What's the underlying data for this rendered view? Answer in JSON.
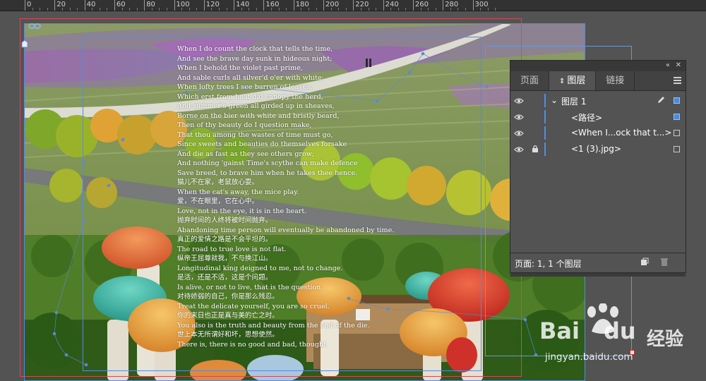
{
  "ruler": {
    "labels": [
      "0",
      "20",
      "40",
      "60",
      "80",
      "100",
      "120",
      "140",
      "160",
      "180",
      "200",
      "220",
      "240",
      "260",
      "280",
      "300"
    ]
  },
  "poem": {
    "lines": [
      "When I do count the clock that tells the time,",
      "And see the brave day sunk in hideous night;",
      "When I behold the violet past prime,",
      "And sable curls all silver'd o'er with white;",
      "When lofty trees I see barren of leaves,",
      "Which erst from heat did canopy the herd,",
      "And summer's green all girded up in sheaves,",
      "Borne on the bier with white and bristly beard,",
      "Then of thy beauty do I question make,",
      "That thou among the wastes of time must go,",
      "Since sweets and beauties do themselves forsake",
      "And die as fast as they see others grow;",
      "And nothing 'gainst Time's scythe can make defence",
      "Save breed, to brave him when he takes thee hence.",
      "猫儿不在家，老鼠放心耍。",
      "When the cat's away, the mice play.",
      "爱，不在眼里，它在心中。",
      "Love, not in the eye, it is in the heart.",
      "抛弃时间的人终将被时间抛弃。",
      "Abandoning time person will eventually be abandoned by time.",
      "真正的爱情之路是不会平坦的。",
      "The road to true love is not flat.",
      "纵帝王屈尊就我，不与换江山。",
      "Longitudinal king deigned to me, not to change.",
      "是活，还是不活，这是个问题。",
      "Is alive, or not to live, that is the question.",
      "对待娇弱的自己，你是那么残忍。",
      "Treat the delicate yourself, you are so cruel.",
      "你的末日也正是真与美的亡之时。",
      "You also is the truth and beauty from the end of the die.",
      "世上本无所谓好和坏，思想使然。",
      "There is, there is no good and bad, thought."
    ]
  },
  "panel": {
    "collapse_label": "«",
    "close_label": "✕",
    "tabs": [
      {
        "label": "页面",
        "active": false
      },
      {
        "label": "图层",
        "active": true
      },
      {
        "label": "链接",
        "active": false
      }
    ],
    "layers": [
      {
        "label": "图层 1",
        "indent": 0,
        "expanded": true,
        "locked": false,
        "square": "filled",
        "pen": true
      },
      {
        "label": "<路径>",
        "indent": 1,
        "locked": false,
        "square": "filled",
        "pen": false
      },
      {
        "label": "<When I...ock that t...>",
        "indent": 1,
        "locked": false,
        "square": "empty",
        "pen": false
      },
      {
        "label": "<1 (3).jpg>",
        "indent": 1,
        "locked": true,
        "square": "empty",
        "pen": false
      }
    ],
    "footer_text": "页面: 1, 1 个图层"
  },
  "watermark": {
    "brand": "Bai",
    "brand2": "du",
    "cn": "经验",
    "url": "jingyan.baidu.com"
  },
  "colors": {
    "accent_blue": "#4a90e2",
    "guide_red": "#d24a5a",
    "guide_blue": "#5a8ad8"
  }
}
